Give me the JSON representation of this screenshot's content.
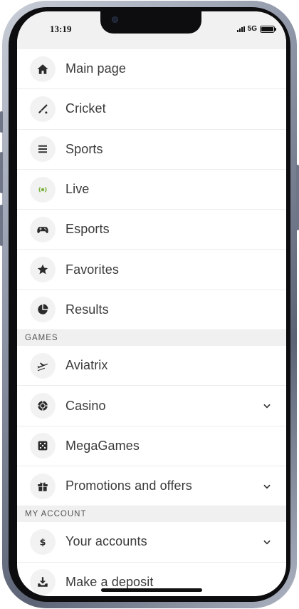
{
  "status_bar": {
    "time": "13:19",
    "network": "5G"
  },
  "menu": {
    "items": [
      {
        "label": "Main page",
        "icon": "home-icon"
      },
      {
        "label": "Cricket",
        "icon": "cricket-bat-icon"
      },
      {
        "label": "Sports",
        "icon": "list-icon"
      },
      {
        "label": "Live",
        "icon": "live-broadcast-icon",
        "icon_color": "#7cb342"
      },
      {
        "label": "Esports",
        "icon": "gamepad-icon"
      },
      {
        "label": "Favorites",
        "icon": "star-icon"
      },
      {
        "label": "Results",
        "icon": "pie-chart-icon"
      }
    ],
    "games_header": "GAMES",
    "games": [
      {
        "label": "Aviatrix",
        "icon": "airplane-icon"
      },
      {
        "label": "Casino",
        "icon": "casino-chip-icon",
        "expandable": true
      },
      {
        "label": "MegaGames",
        "icon": "dice-icon"
      },
      {
        "label": "Promotions and offers",
        "icon": "gift-icon",
        "expandable": true
      }
    ],
    "account_header": "MY ACCOUNT",
    "account": [
      {
        "label": "Your accounts",
        "icon": "dollar-icon",
        "expandable": true
      },
      {
        "label": "Make a deposit",
        "icon": "download-icon"
      }
    ]
  }
}
